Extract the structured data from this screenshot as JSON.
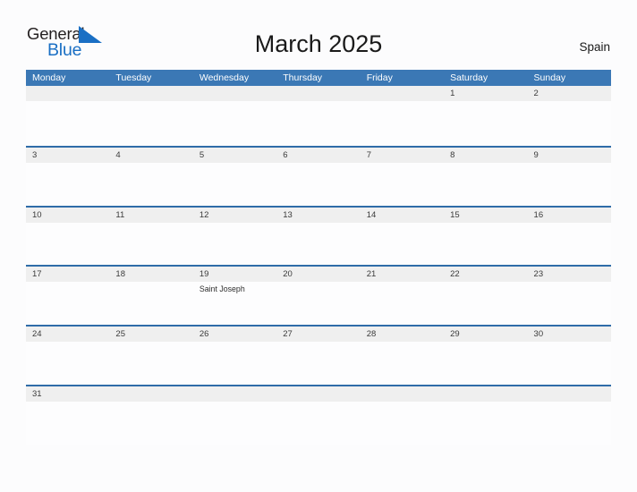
{
  "brand": {
    "word_one": "General",
    "word_two": "Blue",
    "triangle_icon": "blue-triangle-icon",
    "word_one_color": "#231f20",
    "word_two_color": "#1a6fc4"
  },
  "header": {
    "title": "March 2025",
    "country": "Spain"
  },
  "theme": {
    "header_blue": "#3b78b5",
    "row_border_blue": "#2f6ca8",
    "date_strip_gray": "#efefef",
    "page_background": "#fcfcfd"
  },
  "calendar": {
    "month": "March",
    "year": "2025",
    "day_headers": [
      "Monday",
      "Tuesday",
      "Wednesday",
      "Thursday",
      "Friday",
      "Saturday",
      "Sunday"
    ],
    "weeks": [
      [
        {
          "date": "",
          "events": []
        },
        {
          "date": "",
          "events": []
        },
        {
          "date": "",
          "events": []
        },
        {
          "date": "",
          "events": []
        },
        {
          "date": "",
          "events": []
        },
        {
          "date": "1",
          "events": []
        },
        {
          "date": "2",
          "events": []
        }
      ],
      [
        {
          "date": "3",
          "events": []
        },
        {
          "date": "4",
          "events": []
        },
        {
          "date": "5",
          "events": []
        },
        {
          "date": "6",
          "events": []
        },
        {
          "date": "7",
          "events": []
        },
        {
          "date": "8",
          "events": []
        },
        {
          "date": "9",
          "events": []
        }
      ],
      [
        {
          "date": "10",
          "events": []
        },
        {
          "date": "11",
          "events": []
        },
        {
          "date": "12",
          "events": []
        },
        {
          "date": "13",
          "events": []
        },
        {
          "date": "14",
          "events": []
        },
        {
          "date": "15",
          "events": []
        },
        {
          "date": "16",
          "events": []
        }
      ],
      [
        {
          "date": "17",
          "events": []
        },
        {
          "date": "18",
          "events": []
        },
        {
          "date": "19",
          "events": [
            "Saint Joseph"
          ]
        },
        {
          "date": "20",
          "events": []
        },
        {
          "date": "21",
          "events": []
        },
        {
          "date": "22",
          "events": []
        },
        {
          "date": "23",
          "events": []
        }
      ],
      [
        {
          "date": "24",
          "events": []
        },
        {
          "date": "25",
          "events": []
        },
        {
          "date": "26",
          "events": []
        },
        {
          "date": "27",
          "events": []
        },
        {
          "date": "28",
          "events": []
        },
        {
          "date": "29",
          "events": []
        },
        {
          "date": "30",
          "events": []
        }
      ],
      [
        {
          "date": "31",
          "events": []
        },
        {
          "date": "",
          "events": []
        },
        {
          "date": "",
          "events": []
        },
        {
          "date": "",
          "events": []
        },
        {
          "date": "",
          "events": []
        },
        {
          "date": "",
          "events": []
        },
        {
          "date": "",
          "events": []
        }
      ]
    ]
  }
}
